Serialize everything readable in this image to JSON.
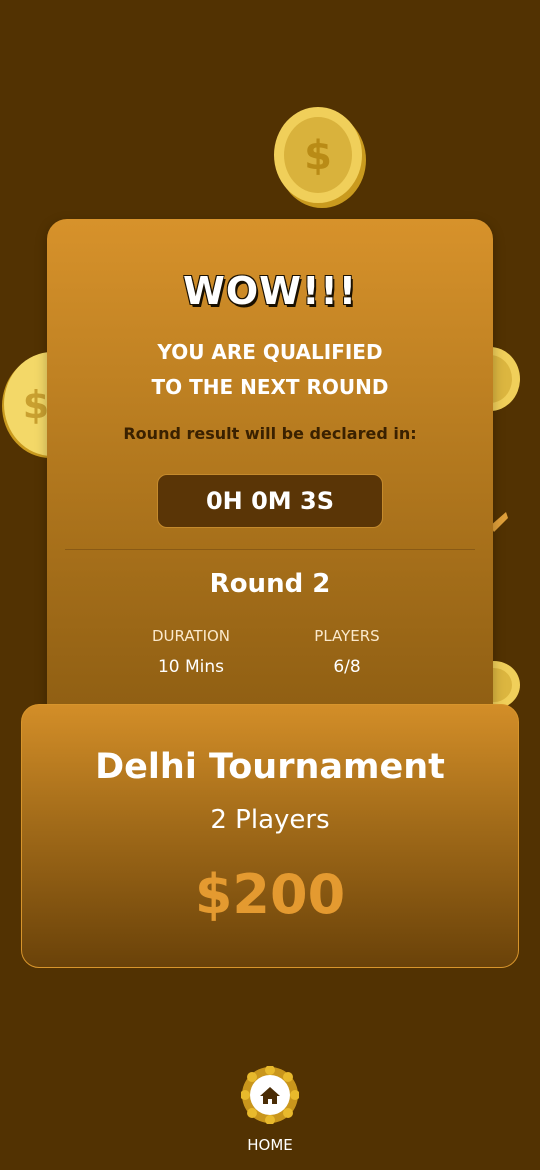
{
  "result": {
    "headline": "WOW!!!",
    "qualified_line1": "YOU ARE QUALIFIED",
    "qualified_line2": "TO THE NEXT ROUND",
    "declared_text": "Round result will be declared in:",
    "timer": "0H 0M 3S"
  },
  "round": {
    "title": "Round 2",
    "duration_label": "DURATION",
    "duration_value": "10 Mins",
    "players_label": "PLAYERS",
    "players_value": "6/8"
  },
  "tournament": {
    "name": "Delhi Tournament",
    "players": "2 Players",
    "prize": "$200"
  },
  "nav": {
    "home_label": "HOME",
    "home_icon": "home-icon"
  },
  "colors": {
    "background": "#523202",
    "accent": "#e49a30",
    "card": "#d7922b"
  }
}
